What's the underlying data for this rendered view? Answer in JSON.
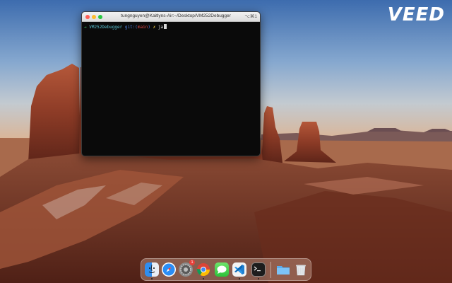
{
  "watermark": {
    "text": "VEED"
  },
  "terminal": {
    "title": "tungnguyen@Kaitlyns-Air:~/Desktop/VM252Debugger",
    "shortcut": "⌥⌘1",
    "prompt": {
      "arrow": "→",
      "directory": "VM252Debugger",
      "git_label": "git:(",
      "branch": "main",
      "git_close": ")",
      "marker": "✗",
      "typed": "ja"
    }
  },
  "dock": {
    "items": [
      {
        "name": "finder-icon",
        "running": true
      },
      {
        "name": "safari-icon",
        "running": false
      },
      {
        "name": "system-settings-icon",
        "running": false,
        "badge": "1"
      },
      {
        "name": "chrome-icon",
        "running": true
      },
      {
        "name": "messages-icon",
        "running": false
      },
      {
        "name": "vscode-icon",
        "running": true
      },
      {
        "name": "terminal-icon",
        "running": true
      },
      {
        "name": "downloads-folder-icon",
        "running": false
      },
      {
        "name": "trash-icon",
        "running": false
      }
    ]
  },
  "colors": {
    "terminal_bg": "#0a0a0a",
    "prompt_green": "#3fd06a",
    "prompt_cyan": "#5cc6d6",
    "git_blue": "#4b7fe0",
    "branch_red": "#e34b4b"
  }
}
